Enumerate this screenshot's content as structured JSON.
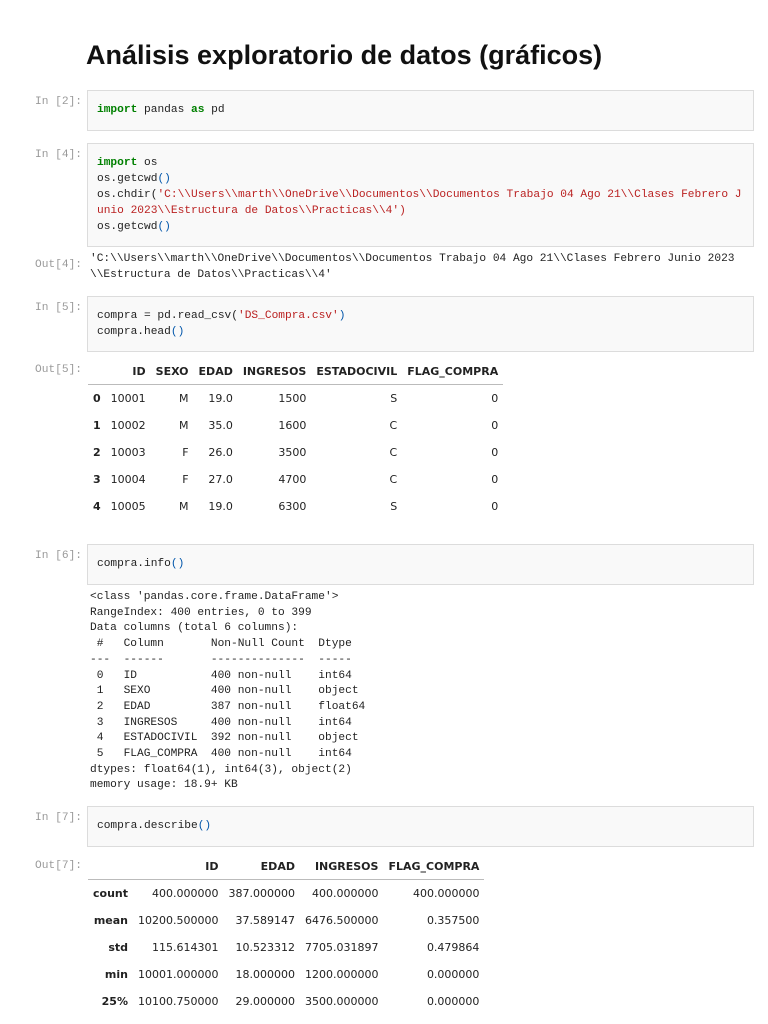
{
  "title": "Análisis exploratorio de datos (gráficos)",
  "cells": {
    "c2": {
      "prompt": "In [2]:",
      "kw1": "import",
      "t1": " pandas ",
      "kw2": "as",
      "t2": " pd"
    },
    "c4": {
      "prompt": "In [4]:",
      "l1kw": "import",
      "l1": " os",
      "l2a": "os.getcwd",
      "l2p": "()",
      "l3a": "os.chdir(",
      "l3s": "'C:\\\\Users\\\\marth\\\\OneDrive\\\\Documentos\\\\Documentos Trabajo 04 Ago 21\\\\Clases Febrero Junio 2023\\\\Estructura de Datos\\\\Practicas\\\\4')",
      "l4a": "os.getcwd",
      "l4p": "()",
      "out_prompt": "Out[4]:",
      "out": "'C:\\\\Users\\\\marth\\\\OneDrive\\\\Documentos\\\\Documentos Trabajo 04 Ago 21\\\\Clases Febrero Junio 2023\n\\\\Estructura de Datos\\\\Practicas\\\\4'"
    },
    "c5": {
      "prompt": "In [5]:",
      "l1a": "compra = pd.read_csv(",
      "l1s": "'DS_Compra.csv'",
      "l1b": ")",
      "l2a": "compra.head",
      "l2p": "()",
      "out_prompt": "Out[5]:",
      "table": {
        "columns": [
          "",
          "ID",
          "SEXO",
          "EDAD",
          "INGRESOS",
          "ESTADOCIVIL",
          "FLAG_COMPRA"
        ],
        "rows": [
          [
            "0",
            "10001",
            "M",
            "19.0",
            "1500",
            "S",
            "0"
          ],
          [
            "1",
            "10002",
            "M",
            "35.0",
            "1600",
            "C",
            "0"
          ],
          [
            "2",
            "10003",
            "F",
            "26.0",
            "3500",
            "C",
            "0"
          ],
          [
            "3",
            "10004",
            "F",
            "27.0",
            "4700",
            "C",
            "0"
          ],
          [
            "4",
            "10005",
            "M",
            "19.0",
            "6300",
            "S",
            "0"
          ]
        ]
      }
    },
    "c6": {
      "prompt": "In [6]:",
      "l1a": "compra.info",
      "l1p": "()",
      "out": "<class 'pandas.core.frame.DataFrame'>\nRangeIndex: 400 entries, 0 to 399\nData columns (total 6 columns):\n #   Column       Non-Null Count  Dtype  \n---  ------       --------------  -----  \n 0   ID           400 non-null    int64  \n 1   SEXO         400 non-null    object \n 2   EDAD         387 non-null    float64\n 3   INGRESOS     400 non-null    int64  \n 4   ESTADOCIVIL  392 non-null    object \n 5   FLAG_COMPRA  400 non-null    int64  \ndtypes: float64(1), int64(3), object(2)\nmemory usage: 18.9+ KB"
    },
    "c7": {
      "prompt": "In [7]:",
      "l1a": "compra.describe",
      "l1p": "()",
      "out_prompt": "Out[7]:",
      "table": {
        "columns": [
          "",
          "ID",
          "EDAD",
          "INGRESOS",
          "FLAG_COMPRA"
        ],
        "rows": [
          [
            "count",
            "400.000000",
            "387.000000",
            "400.000000",
            "400.000000"
          ],
          [
            "mean",
            "10200.500000",
            "37.589147",
            "6476.500000",
            "0.357500"
          ],
          [
            "std",
            "115.614301",
            "10.523312",
            "7705.031897",
            "0.479864"
          ],
          [
            "min",
            "10001.000000",
            "18.000000",
            "1200.000000",
            "0.000000"
          ],
          [
            "25%",
            "10100.750000",
            "29.000000",
            "3500.000000",
            "0.000000"
          ]
        ]
      }
    }
  }
}
